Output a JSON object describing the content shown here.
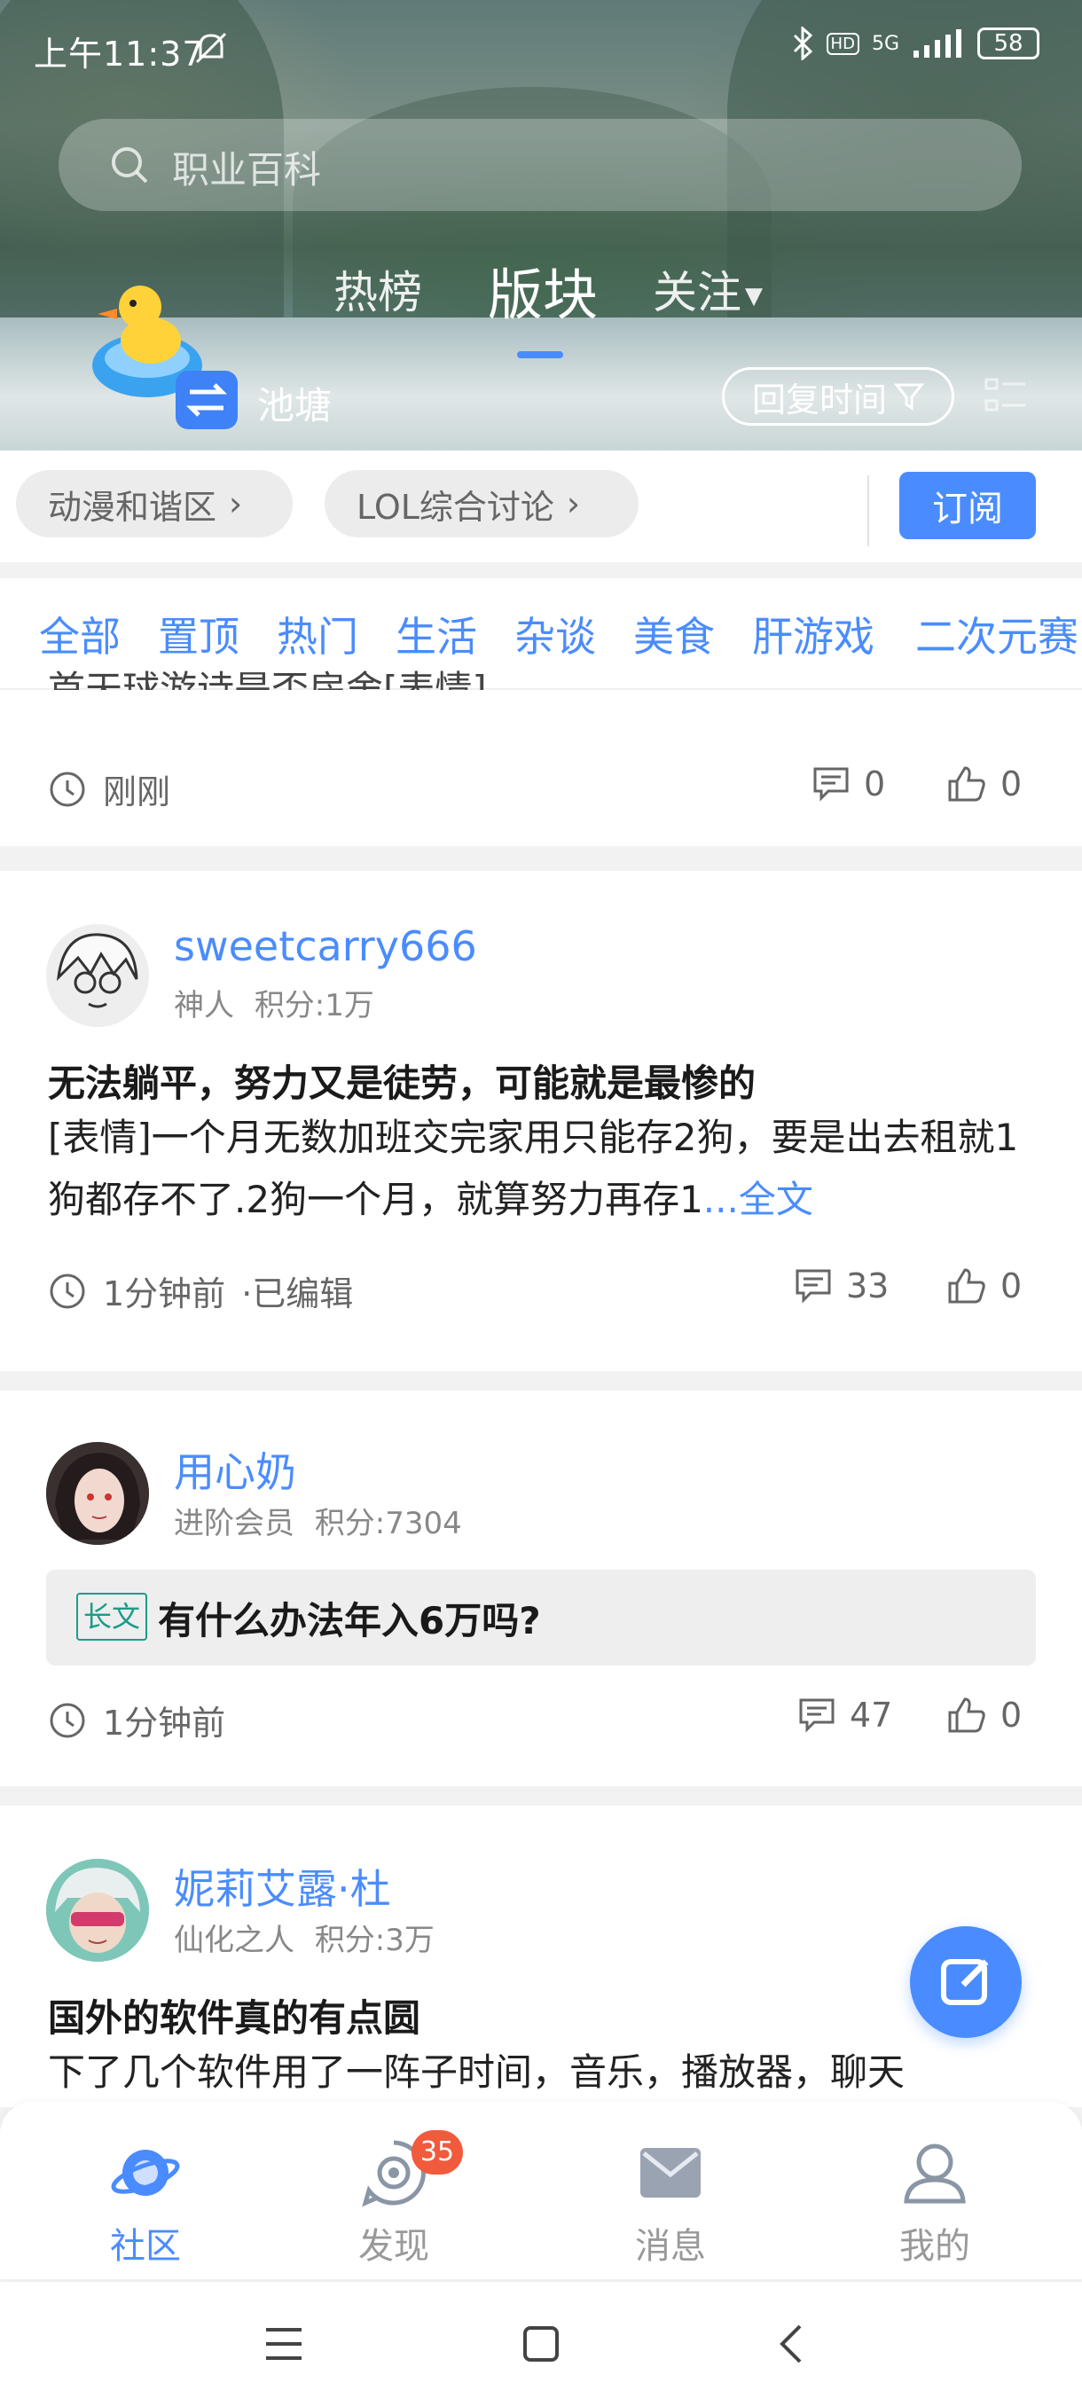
{
  "status": {
    "time": "上午11:37",
    "network": "5G",
    "hd": "HD",
    "battery": "58"
  },
  "search": {
    "placeholder": "职业百科"
  },
  "top_tabs": [
    {
      "label": "热榜"
    },
    {
      "label": "版块"
    },
    {
      "label": "关注"
    }
  ],
  "board": {
    "name": "池塘",
    "sort_label": "回复时间"
  },
  "forum_chips": [
    {
      "label": "动漫和谐区"
    },
    {
      "label": "LOL综合讨论"
    }
  ],
  "subscribe_label": "订阅",
  "categories": [
    "全部",
    "置顶",
    "热门",
    "生活",
    "杂谈",
    "美食",
    "肝游戏",
    "二次元赛"
  ],
  "posts": [
    {
      "partial_text": "首天球游诗是否房舍[表情]",
      "time": "刚刚",
      "comments": "0",
      "likes": "0"
    },
    {
      "username": "sweetcarry666",
      "rank": "神人",
      "score": "积分:1万",
      "title": "无法躺平，努力又是徒劳，可能就是最惨的",
      "body": "[表情]一个月无数加班交完家用只能存2狗，要是出去租就1狗都存不了.2狗一个月，就算努力再存1",
      "more": "...全文",
      "time": "1分钟前",
      "edited": "·已编辑",
      "comments": "33",
      "likes": "0"
    },
    {
      "username": "用心奶",
      "rank": "进阶会员",
      "score": "积分:7304",
      "tag": "长文",
      "title": "有什么办法年入6万吗?",
      "time": "1分钟前",
      "comments": "47",
      "likes": "0"
    },
    {
      "username": "妮莉艾露·杜",
      "rank": "仙化之人",
      "score": "积分:3万",
      "title": "国外的软件真的有点圆",
      "body": "下了几个软件用了一阵子时间，音乐，播放器，聊天"
    }
  ],
  "bottom_nav": [
    {
      "label": "社区",
      "icon": "planet-icon",
      "active": true
    },
    {
      "label": "发现",
      "icon": "discover-icon",
      "badge": "35"
    },
    {
      "label": "消息",
      "icon": "mail-icon"
    },
    {
      "label": "我的",
      "icon": "profile-icon"
    }
  ],
  "colors": {
    "accent": "#4a8cff",
    "badge": "#f25a3c",
    "tag": "#1a9c8a"
  }
}
